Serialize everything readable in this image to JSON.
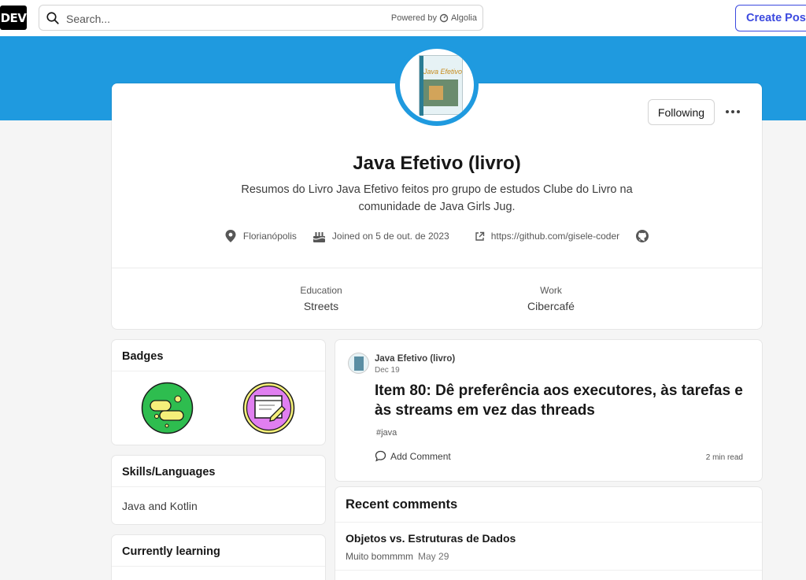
{
  "header": {
    "logo_text": "DEV",
    "search_placeholder": "Search...",
    "powered_by": "Powered by",
    "algolia": "Algolia",
    "create_post": "Create Post"
  },
  "profile": {
    "book_cover_title": "Java Efetivo",
    "following_label": "Following",
    "name": "Java Efetivo (livro)",
    "bio": "Resumos do Livro Java Efetivo feitos pro grupo de estudos Clube do Livro na comunidade de Java Girls Jug.",
    "location": "Florianópolis",
    "joined": "Joined on 5 de out. de 2023",
    "website": "https://github.com/gisele-coder",
    "education_label": "Education",
    "education_value": "Streets",
    "work_label": "Work",
    "work_value": "Cibercafé"
  },
  "sidebar": {
    "badges_title": "Badges",
    "skills_title": "Skills/Languages",
    "skills_value": "Java and Kotlin",
    "learning_title": "Currently learning"
  },
  "article": {
    "author": "Java Efetivo (livro)",
    "date": "Dec 19",
    "title": "Item 80: Dê preferência aos executores, às tarefas e às streams em vez das threads",
    "tag": "#java",
    "add_comment": "Add Comment",
    "read_time": "2 min read"
  },
  "recent_comments": {
    "title": "Recent comments",
    "items": [
      {
        "post_title": "Objetos vs. Estruturas de Dados",
        "snippet": "Muito bommmm",
        "date": "May 29"
      }
    ]
  },
  "colors": {
    "banner": "#1f9adf",
    "accent": "#3b49df",
    "badge_green": "#2ebd4f",
    "badge_purple": "#e07ff0"
  }
}
